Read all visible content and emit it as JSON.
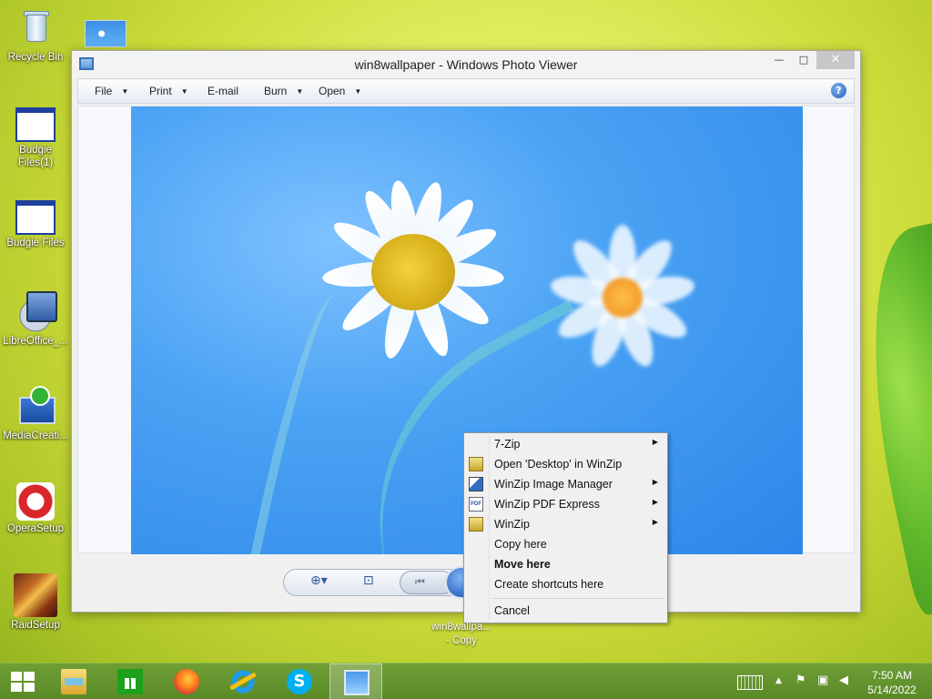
{
  "desktop": {
    "icons": [
      {
        "label": "Recycle Bin"
      },
      {
        "label": "Budgie Files(1)"
      },
      {
        "label": "Budgie Files"
      },
      {
        "label": "LibreOffice_..."
      },
      {
        "label": "MediaCreati..."
      },
      {
        "label": "OperaSetup"
      },
      {
        "label": "RaidSetup"
      }
    ],
    "drag_file_label_line1": "win8wallpa...",
    "drag_file_label_line2": "- Copy"
  },
  "window": {
    "title": "win8wallpaper - Windows Photo Viewer",
    "minimize_glyph": "—",
    "maximize_glyph": "□",
    "close_glyph": "✕",
    "menu": [
      {
        "label": "File",
        "dropdown": true
      },
      {
        "label": "Print",
        "dropdown": true
      },
      {
        "label": "E-mail",
        "dropdown": false
      },
      {
        "label": "Burn",
        "dropdown": true
      },
      {
        "label": "Open",
        "dropdown": true
      }
    ],
    "help_glyph": "?"
  },
  "context_menu": {
    "items": [
      {
        "label": "7-Zip",
        "icon": null,
        "submenu": true
      },
      {
        "label": "Open 'Desktop' in WinZip",
        "icon": "winzip-icon",
        "submenu": false
      },
      {
        "label": "WinZip Image Manager",
        "icon": "winzip-image-icon",
        "submenu": true
      },
      {
        "label": "WinZip PDF Express",
        "icon": "pdf-icon",
        "submenu": true
      },
      {
        "label": "WinZip",
        "icon": "winzip-icon",
        "submenu": true
      },
      {
        "label": "Copy here",
        "icon": null,
        "submenu": false
      },
      {
        "label": "Move here",
        "icon": null,
        "submenu": false,
        "bold": true
      },
      {
        "label": "Create shortcuts here",
        "icon": null,
        "submenu": false
      },
      {
        "label": "Cancel",
        "icon": null,
        "submenu": false
      }
    ],
    "pdf_icon_text": "PDF",
    "submenu_arrow": "▶"
  },
  "taskbar": {
    "clock_time": "7:50 AM",
    "clock_date": "5/14/2022",
    "pinned": [
      "file-explorer",
      "store",
      "firefox",
      "internet-explorer",
      "skype",
      "photo-viewer"
    ],
    "skype_glyph": "S",
    "tray_arrow": "▲"
  },
  "colors": {
    "taskbar": "#6f9e35",
    "photo_sky": "#4ba3f4",
    "close_button": "#c7c7c7"
  }
}
